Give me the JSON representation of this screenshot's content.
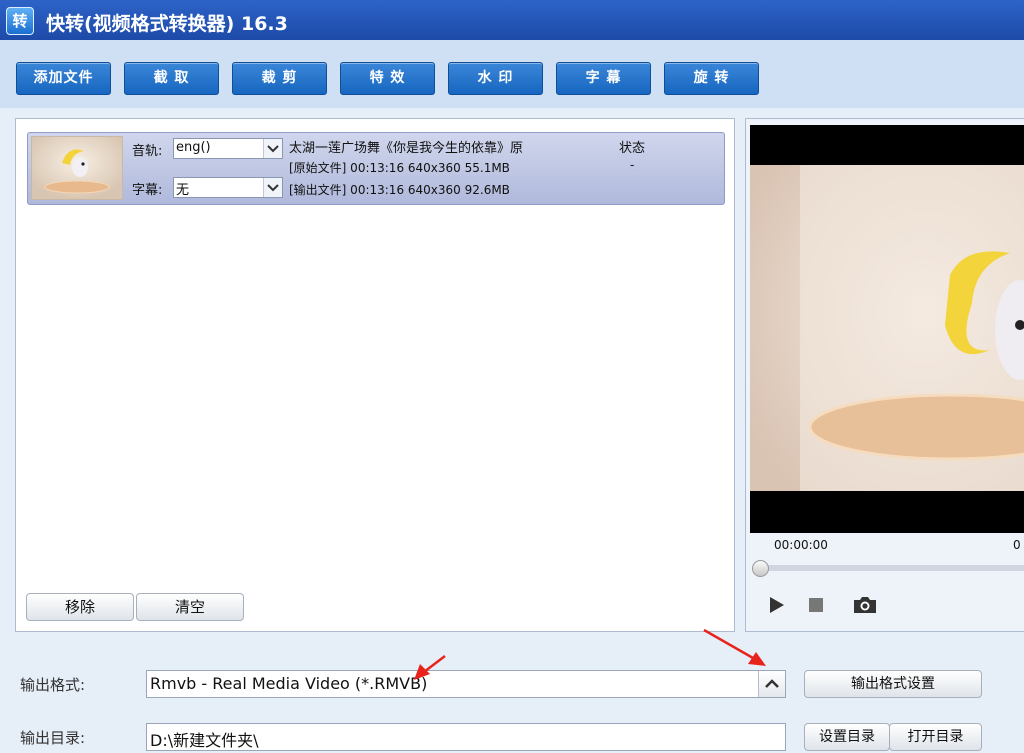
{
  "window": {
    "icon_char": "转",
    "title": "快转(视频格式转换器) 16.3"
  },
  "toolbar": [
    "添加文件",
    "截 取",
    "裁 剪",
    "特 效",
    "水 印",
    "字 幕",
    "旋 转"
  ],
  "file_list": {
    "status_header": "状态",
    "items": [
      {
        "audio_label": "音轨:",
        "audio_value": "eng()",
        "subtitle_label": "字幕:",
        "subtitle_value": "无",
        "name": "太湖一莲广场舞《你是我今生的依靠》原",
        "source_info": "[原始文件]  00:13:16  640x360  55.1MB",
        "output_info": "[输出文件]  00:13:16  640x360  92.6MB",
        "status": "-"
      }
    ],
    "remove_label": "移除",
    "clear_label": "清空"
  },
  "player": {
    "time_current": "00:00:00",
    "time_total_partial": "0",
    "progress": 0
  },
  "output": {
    "format_label": "输出格式:",
    "format_value": "Rmvb - Real Media Video (*.RMVB)",
    "format_settings_label": "输出格式设置",
    "dir_label": "输出目录:",
    "dir_value": "D:\\新建文件夹\\",
    "set_dir_label": "设置目录",
    "open_dir_label": "打开目录"
  },
  "colors": {
    "titlebar": "#1d4aa8",
    "toolbar_button": "#1766c0",
    "selected_row": "#b0b9dc",
    "annotation_arrow": "#e8231c"
  }
}
